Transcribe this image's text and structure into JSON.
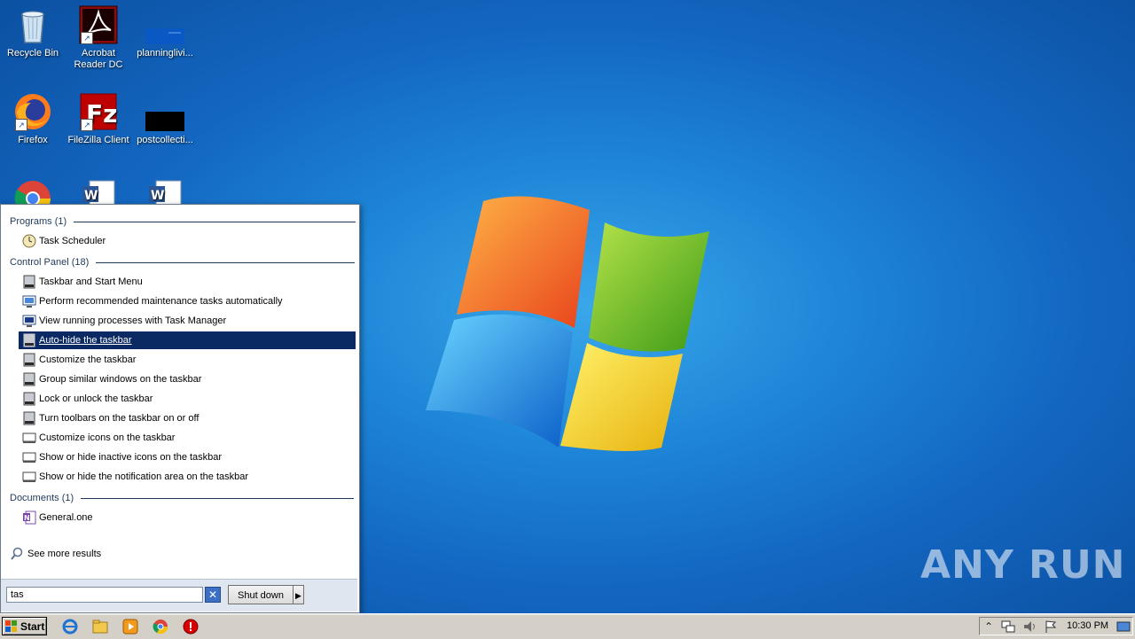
{
  "desktop": {
    "icons": [
      {
        "label": "Recycle Bin"
      },
      {
        "label": "Acrobat Reader DC"
      },
      {
        "label": "planninglivi..."
      },
      {
        "label": "Firefox"
      },
      {
        "label": "FileZilla Client"
      },
      {
        "label": "postcollecti..."
      },
      {
        "label": ""
      },
      {
        "label": ""
      },
      {
        "label": ""
      }
    ]
  },
  "search_panel": {
    "sections": {
      "programs": "Programs (1)",
      "control_panel": "Control Panel (18)",
      "documents": "Documents (1)"
    },
    "programs": [
      {
        "label": "Task Scheduler",
        "icon": "clock-icon"
      }
    ],
    "control_panel": [
      {
        "label": "Taskbar and Start Menu",
        "icon": "taskbar-icon"
      },
      {
        "label": "Perform recommended maintenance tasks automatically",
        "icon": "action-center-icon"
      },
      {
        "label": "View running processes with Task Manager",
        "icon": "monitor-icon"
      },
      {
        "label": "Auto-hide the taskbar",
        "icon": "taskbar-icon",
        "selected": true
      },
      {
        "label": "Customize the taskbar",
        "icon": "taskbar-icon"
      },
      {
        "label": "Group similar windows on the taskbar",
        "icon": "taskbar-icon"
      },
      {
        "label": "Lock or unlock the taskbar",
        "icon": "taskbar-icon"
      },
      {
        "label": "Turn toolbars on the taskbar on or off",
        "icon": "taskbar-icon"
      },
      {
        "label": "Customize icons on the taskbar",
        "icon": "notification-icon"
      },
      {
        "label": "Show or hide inactive icons on the taskbar",
        "icon": "notification-icon"
      },
      {
        "label": "Show or hide the notification area on the taskbar",
        "icon": "notification-icon"
      }
    ],
    "documents": [
      {
        "label": "General.one",
        "icon": "onenote-icon"
      }
    ],
    "see_more": "See more results",
    "search_value": "tas",
    "shutdown_label": "Shut down"
  },
  "taskbar": {
    "start_label": "Start",
    "clock": "10:30 PM"
  },
  "watermark": "ANY RUN",
  "colors": {
    "selection": "#0b2a64",
    "section_heading": "#1e395b",
    "taskbar": "#d4d0c8"
  }
}
